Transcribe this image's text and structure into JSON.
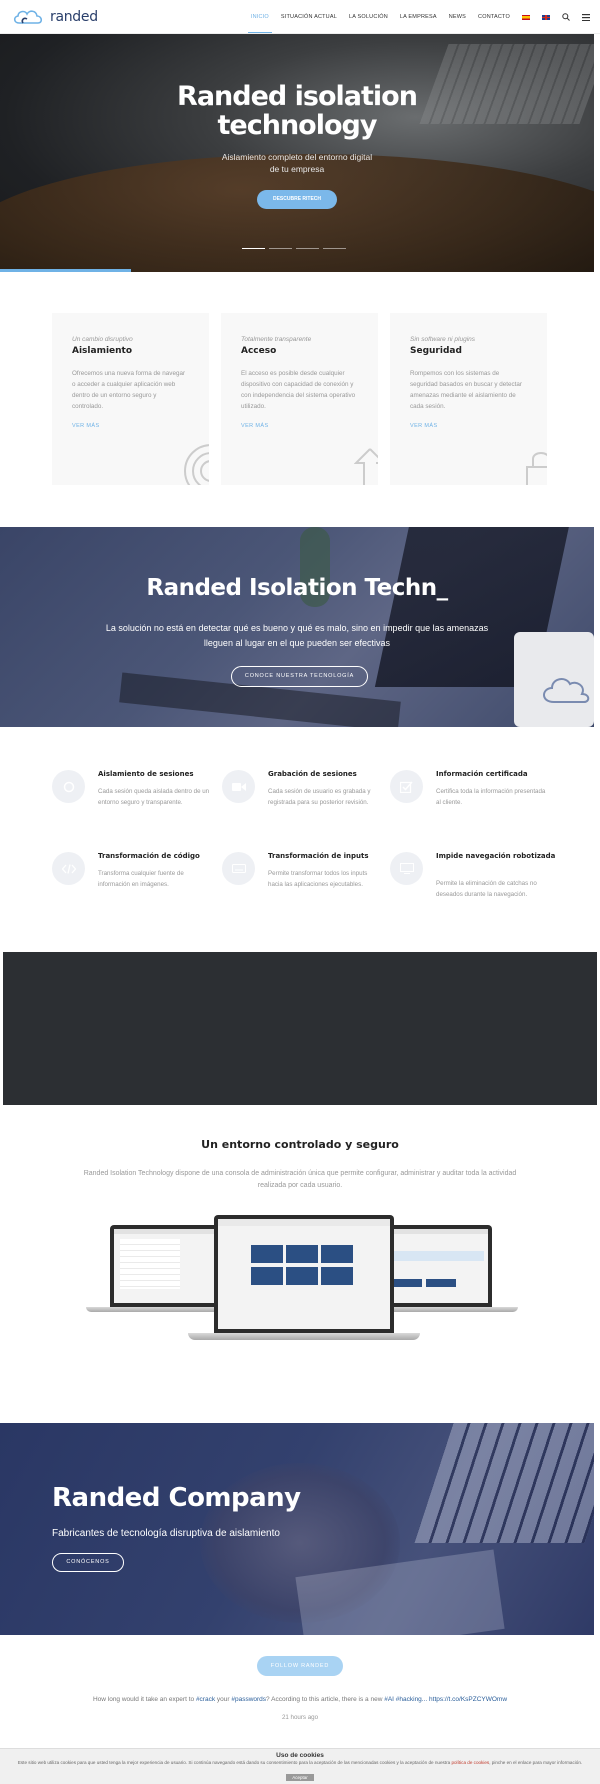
{
  "header": {
    "logo_text": "randed",
    "nav": [
      {
        "label": "Inicio",
        "active": true
      },
      {
        "label": "Situación actual"
      },
      {
        "label": "La solución"
      },
      {
        "label": "La empresa"
      },
      {
        "label": "News"
      },
      {
        "label": "Contacto"
      }
    ],
    "icons": [
      "flag-es",
      "flag-uk",
      "search-icon",
      "menu-icon"
    ]
  },
  "hero": {
    "title_line1": "Randed isolation",
    "title_line2": "technology",
    "subtitle_line1": "Aislamiento completo del entorno digital",
    "subtitle_line2": "de tu empresa",
    "button": "Descubre RITech",
    "slides": 4,
    "active_slide": 1,
    "progress": 0.22
  },
  "cards": [
    {
      "kicker": "Un cambio disruptivo",
      "title": "Aislamiento",
      "text": "Ofrecemos una nueva forma de navegar o acceder a cualquier aplicación web dentro de un entorno seguro y controlado.",
      "link": "Ver más",
      "icon": "target-icon"
    },
    {
      "kicker": "Totalmente transparente",
      "title": "Acceso",
      "text": "El acceso es posible desde cualquier dispositivo con capacidad de conexión y con independencia del sistema operativo utilizado.",
      "link": "Ver más",
      "icon": "arrow-icon"
    },
    {
      "kicker": "Sin software ni plugins",
      "title": "Seguridad",
      "text": "Rompemos con los sistemas de seguridad basados en buscar y detectar amenazas mediante el aislamiento de cada sesión.",
      "link": "Ver más",
      "icon": "lock-icon"
    }
  ],
  "banner": {
    "title": "Randed Isolation Techn_",
    "text_line1": "La solución no está en detectar qué es bueno y qué es malo, sino en impedir que las amenazas",
    "text_line2": "lleguen al lugar en el que pueden ser efectivas",
    "button": "Conoce nuestra tecnología"
  },
  "features": [
    {
      "title": "Aislamiento de sesiones",
      "text": "Cada sesión queda aislada dentro de un entorno seguro y transparente.",
      "icon": "circle-icon"
    },
    {
      "title": "Grabación de sesiones",
      "text": "Cada sesión de usuario es grabada y registrada para su posterior revisión.",
      "icon": "video-icon"
    },
    {
      "title": "Información certificada",
      "text": "Certifica toda la información presentada al cliente.",
      "icon": "check-icon"
    },
    {
      "title": "Transformación de código",
      "text": "Transforma cualquier fuente de información en imágenes.",
      "icon": "code-icon"
    },
    {
      "title": "Transformación de inputs",
      "text": "Permite transformar todos los inputs hacia las aplicaciones ejecutables.",
      "icon": "keyboard-icon"
    },
    {
      "title": "Impide navegación robotizada",
      "text": "Permite la eliminación de catchas no deseados durante la navegación.",
      "icon": "screen-icon"
    }
  ],
  "console": {
    "title": "Un entorno controlado y seguro",
    "text_line1": "Randed Isolation Technology dispone de una consola de administración única que permite configurar, administrar y auditar toda la actividad",
    "text_line2": "realizada por cada usuario."
  },
  "company": {
    "title": "Randed Company",
    "subtitle": "Fabricantes de tecnología disruptiva de aislamiento",
    "button": "Conócenos"
  },
  "twitter": {
    "button": "Follow Randed",
    "tweet_prefix": "How long would it take an expert to ",
    "tag_crack": "#crack",
    "tweet_mid1": " your ",
    "tag_passwords": "#passwords",
    "tweet_mid2": "? According to this article, there is a new ",
    "tag_ai": "#AI",
    "tweet_mid3": " ",
    "tag_hacking": "#hacking...",
    "tweet_link": " https://t.co/KsPZCYWOmw",
    "time": "21 hours ago"
  },
  "cookie": {
    "title": "Uso de cookies",
    "text_before": "Este sitio web utiliza cookies para que usted tenga la mejor experiencia de usuario. Si continúa navegando está dando su consentimiento para la aceptación de las mencionadas cookies y la aceptación de nuestra ",
    "link": "política de cookies",
    "text_after": ", pinche en el enlace para mayor información.",
    "button": "Aceptar"
  },
  "colors": {
    "accent": "#6fb2e6",
    "dark": "#2c2f33",
    "navy": "#2a3764"
  }
}
